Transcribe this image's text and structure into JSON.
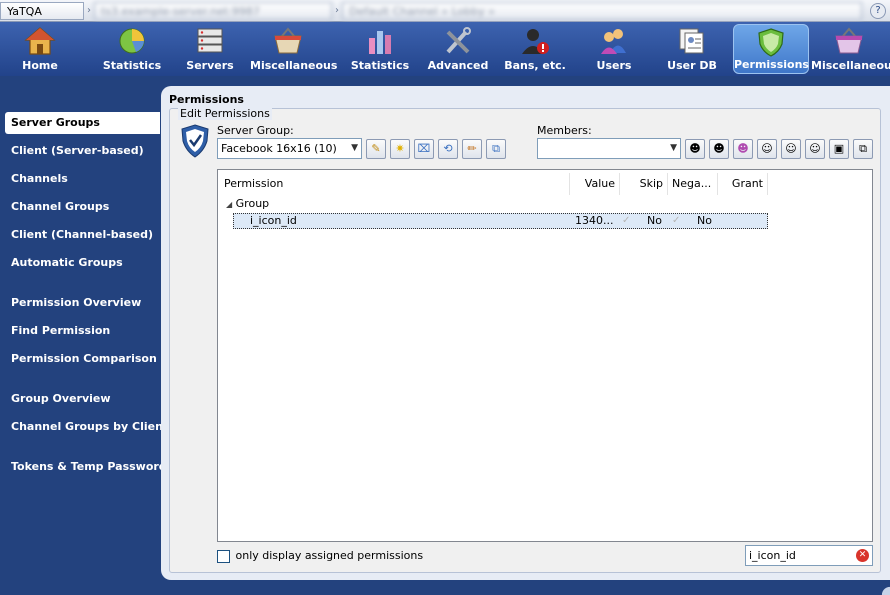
{
  "breadcrumb": {
    "app": "YaTQA",
    "server": "ts3.example-server.net:9987",
    "channel": "Default Channel » Lobby »"
  },
  "toolbar": {
    "items": [
      {
        "label": "Home",
        "icon": "home-icon"
      },
      {
        "label": "Statistics",
        "icon": "pie-chart-icon"
      },
      {
        "label": "Servers",
        "icon": "servers-icon"
      },
      {
        "label": "Miscellaneous",
        "icon": "basket-icon"
      },
      {
        "label": "Statistics",
        "icon": "bar-chart-icon"
      },
      {
        "label": "Advanced",
        "icon": "tools-icon"
      },
      {
        "label": "Bans, etc.",
        "icon": "ban-icon"
      },
      {
        "label": "Users",
        "icon": "users-icon"
      },
      {
        "label": "User DB",
        "icon": "user-db-icon"
      },
      {
        "label": "Permissions",
        "icon": "shield-icon",
        "active": true
      },
      {
        "label": "Miscellaneous",
        "icon": "basket-icon"
      }
    ]
  },
  "sidebar": {
    "items": [
      {
        "label": "Server Groups",
        "active": true
      },
      {
        "label": "Client (Server-based)"
      },
      {
        "label": "Channels"
      },
      {
        "label": "Channel Groups"
      },
      {
        "label": "Client (Channel-based)"
      },
      {
        "label": "Automatic Groups"
      },
      {
        "label": "Permission Overview"
      },
      {
        "label": "Find Permission"
      },
      {
        "label": "Permission Comparison"
      },
      {
        "label": "Group Overview"
      },
      {
        "label": "Channel Groups by Client"
      },
      {
        "label": "Tokens & Temp Passwords"
      }
    ]
  },
  "panel": {
    "title": "Permissions",
    "group_box_title": "Edit Permissions",
    "server_group_label": "Server Group:",
    "server_group_value": "Facebook 16x16 (10)",
    "members_label": "Members:",
    "members_value": ""
  },
  "table": {
    "columns": [
      "Permission",
      "Value",
      "Skip",
      "Nega...",
      "Grant"
    ],
    "group_name": "Group",
    "rows": [
      {
        "permission": "i_icon_id",
        "value": "1340...",
        "skip": "No",
        "negate": "No",
        "grant": ""
      }
    ]
  },
  "footer": {
    "only_assigned_label": "only display assigned permissions",
    "search_value": "i_icon_id"
  }
}
